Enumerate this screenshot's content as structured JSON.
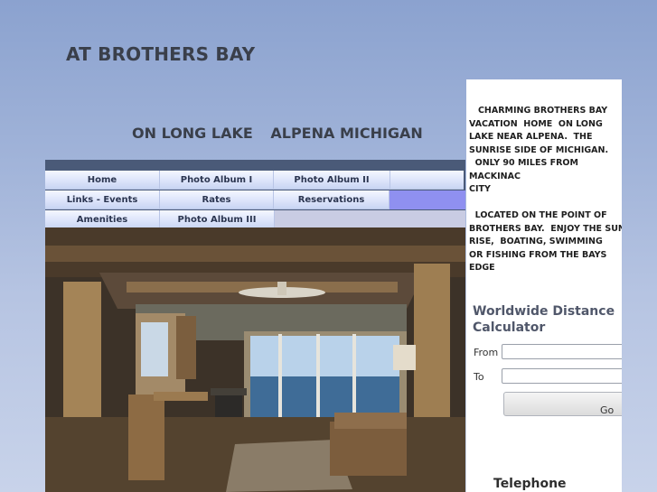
{
  "header": {
    "site_title": "AT BROTHERS BAY",
    "subtitle_left": "ON LONG LAKE",
    "subtitle_right": "ALPENA MICHIGAN"
  },
  "nav": {
    "row1": [
      "Home",
      "Photo Album I",
      "Photo Album II"
    ],
    "row2": [
      "Links - Events",
      "Rates",
      "Reservations"
    ],
    "row3": [
      "Amenities",
      "Photo Album III"
    ]
  },
  "sidebar": {
    "intro_text": "   CHARMING BROTHERS BAY\nVACATION  HOME  ON LONG\nLAKE NEAR ALPENA.  THE\nSUNRISE SIDE OF MICHIGAN.\n  ONLY 90 MILES FROM MACKINAC\nCITY\n\n  LOCATED ON THE POINT OF\nBROTHERS BAY.  ENJOY THE SUN\nRISE,  BOATING, SWIMMING\nOR FISHING FROM THE BAYS\nEDGE",
    "calculator": {
      "title": "Worldwide Distance Calculator",
      "from_label": "From",
      "to_label": "To",
      "from_value": "",
      "to_value": "",
      "go_label": "Go"
    },
    "telephone_label": "Telephone"
  },
  "photo": {
    "description_icon": "cabin-interior-photo"
  }
}
